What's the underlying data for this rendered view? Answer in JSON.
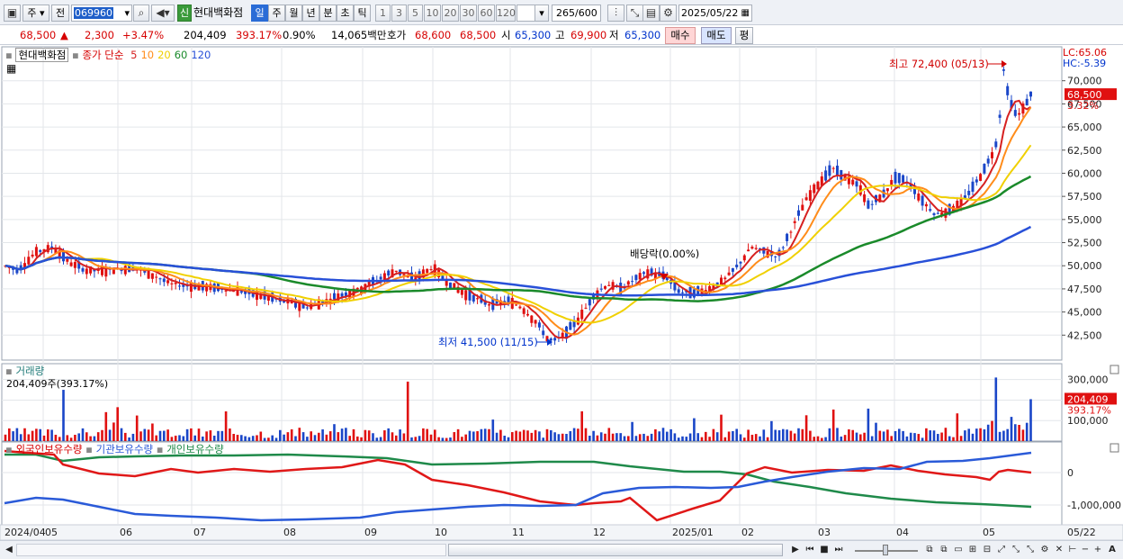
{
  "toolbar": {
    "market": "주",
    "prev": "전",
    "stock_code": "069960",
    "new_badge": "신",
    "stock_name": "현대백화점",
    "periods": [
      "일",
      "주",
      "월",
      "년",
      "분",
      "초",
      "틱"
    ],
    "active_period": "일",
    "intervals": [
      "1",
      "3",
      "5",
      "10",
      "20",
      "30",
      "60",
      "120"
    ],
    "count": "265",
    "count_total": "/600",
    "date": "2025/05/22"
  },
  "quote": {
    "price": "68,500",
    "change": "2,300",
    "change_pct": "+3.47%",
    "volume": "204,409",
    "volume_ratio": "393.17%",
    "turnover": "0.90%",
    "amount": "14,065백만",
    "ask_label": "호가",
    "ask": "68,600",
    "bid": "68,500",
    "open_label": "시",
    "open": "65,300",
    "high_label": "고",
    "high": "69,900",
    "low_label": "저",
    "low": "65,300",
    "buy_btn": "매수",
    "sell_btn": "매도",
    "eval_btn": "평"
  },
  "price_pane": {
    "legend_name": "현대백화점",
    "legend_ma_title": "종가 단순",
    "ma_periods": [
      "5",
      "10",
      "20",
      "60",
      "120"
    ],
    "ma_colors": [
      "#d62020",
      "#ff8c1a",
      "#f0d000",
      "#1a8a2a",
      "#2850d8"
    ],
    "lc": "LC:65.06",
    "hc": "HC:-5.39",
    "current_price": "68,500",
    "current_pct": "3.32%",
    "high_annotation": "최고 72,400 (05/13)",
    "low_annotation": "최저 41,500 (11/15)",
    "dividend_annotation": "배당락(0.00%)",
    "y_ticks": [
      "70,000",
      "67,500",
      "65,000",
      "62,500",
      "60,000",
      "57,500",
      "55,000",
      "52,500",
      "50,000",
      "47,500",
      "45,000",
      "42,500"
    ]
  },
  "volume_pane": {
    "title": "거래량",
    "value": "204,409주(393.17%)",
    "y_ticks": [
      "300,000",
      "200,000",
      "100,000"
    ],
    "current": "204,409",
    "current_pct": "393.17%"
  },
  "holdings_pane": {
    "series": [
      "외국인보유수량",
      "기관보유수량",
      "개인보유수량"
    ],
    "series_colors": [
      "#e01818",
      "#2a5ad8",
      "#1f8a4a"
    ],
    "y_ticks": [
      "0",
      "-1,000,000"
    ]
  },
  "x_axis": {
    "labels": [
      "2024/04",
      "05",
      "06",
      "07",
      "08",
      "09",
      "10",
      "11",
      "12",
      "2025/01",
      "02",
      "03",
      "04",
      "05",
      "05/22"
    ]
  },
  "chart_data": {
    "type": "line",
    "title": "현대백화점",
    "x_range": [
      "2024/04",
      "2025/05/22"
    ],
    "y_range": [
      40000,
      72500
    ],
    "series": [
      {
        "name": "종가",
        "x": [
          "2024/04",
          "2024/05",
          "2024/06",
          "2024/07",
          "2024/08",
          "2024/09",
          "2024/10",
          "2024/11",
          "2024/11/15",
          "2024/12",
          "2025/01",
          "2025/02",
          "2025/03",
          "2025/04",
          "2025/05",
          "2025/05/13",
          "2025/05/22"
        ],
        "values": [
          50000,
          52000,
          49500,
          47500,
          46500,
          49500,
          48000,
          45500,
          41500,
          47500,
          46500,
          51500,
          60000,
          56500,
          60000,
          72400,
          68500
        ]
      },
      {
        "name": "120",
        "x": [
          "2024/04",
          "2024/06",
          "2024/08",
          "2024/10",
          "2024/12",
          "2025/02",
          "2025/04",
          "2025/05/22"
        ],
        "values": [
          52000,
          51500,
          50000,
          48500,
          47000,
          47000,
          50500,
          54000
        ]
      }
    ],
    "annotations": [
      "최고 72,400 (05/13)",
      "최저 41,500 (11/15)",
      "배당락(0.00%)"
    ]
  }
}
